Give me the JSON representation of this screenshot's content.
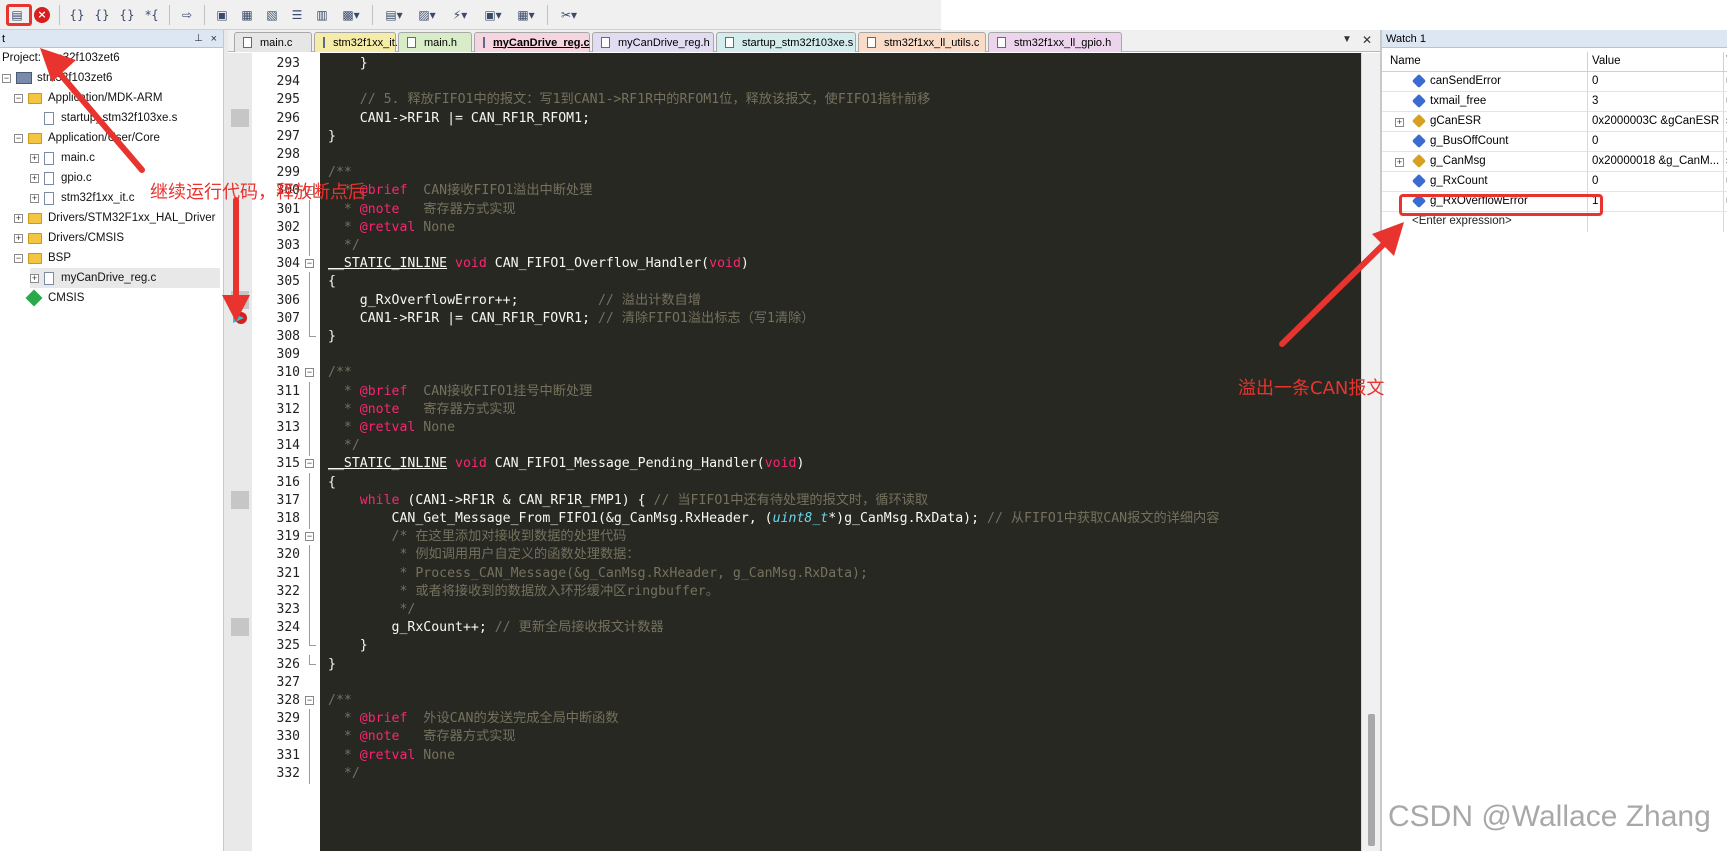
{
  "toolbar": {
    "buttons": [
      "build-icon",
      "stop-icon",
      "step-into-icon",
      "step-over-icon",
      "step-out-icon",
      "run-to-cursor-icon",
      "show-next-statement-icon",
      "command-window-icon",
      "disassembly-icon",
      "symbols-icon",
      "registers-icon",
      "call-stack-icon",
      "watch-icon",
      "memory-icon",
      "serial-icon",
      "analysis-icon",
      "trace-icon",
      "system-viewer-icon",
      "toolbox-icon"
    ]
  },
  "project_panel": {
    "title": "t",
    "items": [
      {
        "label": "Project: stm32f103zet6",
        "indent": 0
      },
      {
        "label": "stm32f103zet6",
        "indent": 1
      },
      {
        "label": "Application/MDK-ARM",
        "indent": 2
      },
      {
        "label": "startup_stm32f103xe.s",
        "indent": 3
      },
      {
        "label": "Application/User/Core",
        "indent": 2
      },
      {
        "label": "main.c",
        "indent": 3
      },
      {
        "label": "gpio.c",
        "indent": 3
      },
      {
        "label": "stm32f1xx_it.c",
        "indent": 3
      },
      {
        "label": "Drivers/STM32F1xx_HAL_Driver",
        "indent": 2
      },
      {
        "label": "Drivers/CMSIS",
        "indent": 2
      },
      {
        "label": "BSP",
        "indent": 2
      },
      {
        "label": "myCanDrive_reg.c",
        "indent": 3
      },
      {
        "label": "CMSIS",
        "indent": 2
      }
    ]
  },
  "tabs": [
    {
      "label": "main.c",
      "color": "#e6e6e6"
    },
    {
      "label": "stm32f1xx_it.c",
      "color": "#f5eca8"
    },
    {
      "label": "main.h",
      "color": "#d8ecc8"
    },
    {
      "label": "myCanDrive_reg.c",
      "color": "#f6d4e0"
    },
    {
      "label": "myCanDrive_reg.h",
      "color": "#e2dcf2"
    },
    {
      "label": "startup_stm32f103xe.s",
      "color": "#d4ecec"
    },
    {
      "label": "stm32f1xx_ll_utils.c",
      "color": "#f8dcc8"
    },
    {
      "label": "stm32f1xx_ll_gpio.h",
      "color": "#ecd4ec"
    }
  ],
  "editor": {
    "line_numbers": [
      "293",
      "294",
      "295",
      "296",
      "297",
      "298",
      "299",
      "300",
      "301",
      "302",
      "303",
      "304",
      "305",
      "306",
      "307",
      "308",
      "309",
      "310",
      "311",
      "312",
      "313",
      "314",
      "315",
      "316",
      "317",
      "318",
      "319",
      "320",
      "321",
      "322",
      "323",
      "324",
      "325",
      "326",
      "327",
      "328",
      "329",
      "330",
      "331",
      "332"
    ],
    "lines": [
      [
        [
          "p",
          "    }"
        ]
      ],
      [],
      [
        [
          "c",
          "    // 5. 释放FIFO1中的报文：写1到CAN1->RF1R中的RFOM1位，释放该报文，使FIFO1指针前移"
        ]
      ],
      [
        [
          "p",
          "    CAN1->RF1R |= CAN_RF1R_RFOM1;"
        ]
      ],
      [
        [
          "p",
          "}"
        ]
      ],
      [],
      [
        [
          "c",
          "/**"
        ]
      ],
      [
        [
          "c",
          "  * "
        ],
        [
          "t",
          "@brief"
        ],
        [
          "c",
          "  CAN接收FIFO1溢出中断处理"
        ]
      ],
      [
        [
          "c",
          "  * "
        ],
        [
          "t",
          "@note"
        ],
        [
          "c",
          "   寄存器方式实现"
        ]
      ],
      [
        [
          "c",
          "  * "
        ],
        [
          "t",
          "@retval"
        ],
        [
          "c",
          " None"
        ]
      ],
      [
        [
          "c",
          "  */"
        ]
      ],
      [
        [
          "m",
          "__STATIC_INLINE"
        ],
        [
          "p",
          " "
        ],
        [
          "k",
          "void"
        ],
        [
          "p",
          " CAN_FIFO1_Overflow_Handler("
        ],
        [
          "k",
          "void"
        ],
        [
          "p",
          ")"
        ]
      ],
      [
        [
          "p",
          "{"
        ]
      ],
      [
        [
          "p",
          "    g_RxOverflowError++;          "
        ],
        [
          "c",
          "// 溢出计数自增"
        ]
      ],
      [
        [
          "p",
          "    CAN1->RF1R |= CAN_RF1R_FOVR1; "
        ],
        [
          "c",
          "// 清除FIFO1溢出标志（写1清除）"
        ]
      ],
      [
        [
          "p",
          "}"
        ]
      ],
      [],
      [
        [
          "c",
          "/**"
        ]
      ],
      [
        [
          "c",
          "  * "
        ],
        [
          "t",
          "@brief"
        ],
        [
          "c",
          "  CAN接收FIFO1挂号中断处理"
        ]
      ],
      [
        [
          "c",
          "  * "
        ],
        [
          "t",
          "@note"
        ],
        [
          "c",
          "   寄存器方式实现"
        ]
      ],
      [
        [
          "c",
          "  * "
        ],
        [
          "t",
          "@retval"
        ],
        [
          "c",
          " None"
        ]
      ],
      [
        [
          "c",
          "  */"
        ]
      ],
      [
        [
          "m",
          "__STATIC_INLINE"
        ],
        [
          "p",
          " "
        ],
        [
          "k",
          "void"
        ],
        [
          "p",
          " CAN_FIFO1_Message_Pending_Handler("
        ],
        [
          "k",
          "void"
        ],
        [
          "p",
          ")"
        ]
      ],
      [
        [
          "p",
          "{"
        ]
      ],
      [
        [
          "p",
          "    "
        ],
        [
          "k",
          "while"
        ],
        [
          "p",
          " (CAN1->RF1R & CAN_RF1R_FMP1) { "
        ],
        [
          "c",
          "// 当FIFO1中还有待处理的报文时，循环读取"
        ]
      ],
      [
        [
          "p",
          "        CAN_Get_Message_From_FIFO1(&g_CanMsg.RxHeader, ("
        ],
        [
          "y",
          "uint8_t"
        ],
        [
          "p",
          "*)g_CanMsg.RxData); "
        ],
        [
          "c",
          "// 从FIFO1中获取CAN报文的详细内容"
        ]
      ],
      [
        [
          "c",
          "        /* 在这里添加对接收到数据的处理代码"
        ]
      ],
      [
        [
          "c",
          "         * 例如调用用户自定义的函数处理数据："
        ]
      ],
      [
        [
          "c",
          "         * Process_CAN_Message(&g_CanMsg.RxHeader, g_CanMsg.RxData);"
        ]
      ],
      [
        [
          "c",
          "         * 或者将接收到的数据放入环形缓冲区ringbuffer。"
        ]
      ],
      [
        [
          "c",
          "         */"
        ]
      ],
      [
        [
          "p",
          "        g_RxCount++; "
        ],
        [
          "c",
          "// 更新全局接收报文计数器"
        ]
      ],
      [
        [
          "p",
          "    }"
        ]
      ],
      [
        [
          "p",
          "}"
        ]
      ],
      [],
      [
        [
          "c",
          "/**"
        ]
      ],
      [
        [
          "c",
          "  * "
        ],
        [
          "t",
          "@brief"
        ],
        [
          "c",
          "  外设CAN的发送完成全局中断函数"
        ]
      ],
      [
        [
          "c",
          "  * "
        ],
        [
          "t",
          "@note"
        ],
        [
          "c",
          "   寄存器方式实现"
        ]
      ],
      [
        [
          "c",
          "  * "
        ],
        [
          "t",
          "@retval"
        ],
        [
          "c",
          " None"
        ]
      ],
      [
        [
          "c",
          "  */"
        ]
      ]
    ]
  },
  "watch": {
    "title": "Watch 1",
    "columns": {
      "name": "Name",
      "value": "Value",
      "type": "T"
    },
    "rows": [
      {
        "name": "canSendError",
        "value": "0",
        "type": "u",
        "struct": false
      },
      {
        "name": "txmail_free",
        "value": "3",
        "type": "u",
        "struct": false
      },
      {
        "name": "gCanESR",
        "value": "0x2000003C &gCanESR",
        "type": "s",
        "struct": true
      },
      {
        "name": "g_BusOffCount",
        "value": "0",
        "type": "u",
        "struct": false
      },
      {
        "name": "g_CanMsg",
        "value": "0x20000018 &g_CanM...",
        "type": "s",
        "struct": true
      },
      {
        "name": "g_RxCount",
        "value": "0",
        "type": "u",
        "struct": false
      },
      {
        "name": "g_RxOverflowError",
        "value": "1",
        "type": "u",
        "struct": false
      }
    ],
    "enter_expression": "<Enter expression>"
  },
  "annotations": {
    "continue_label": "继续运行代码，释放断点后",
    "overflow_label": "溢出一条CAN报文",
    "watermark": "CSDN @Wallace Zhang",
    "color": "#e8332e"
  }
}
